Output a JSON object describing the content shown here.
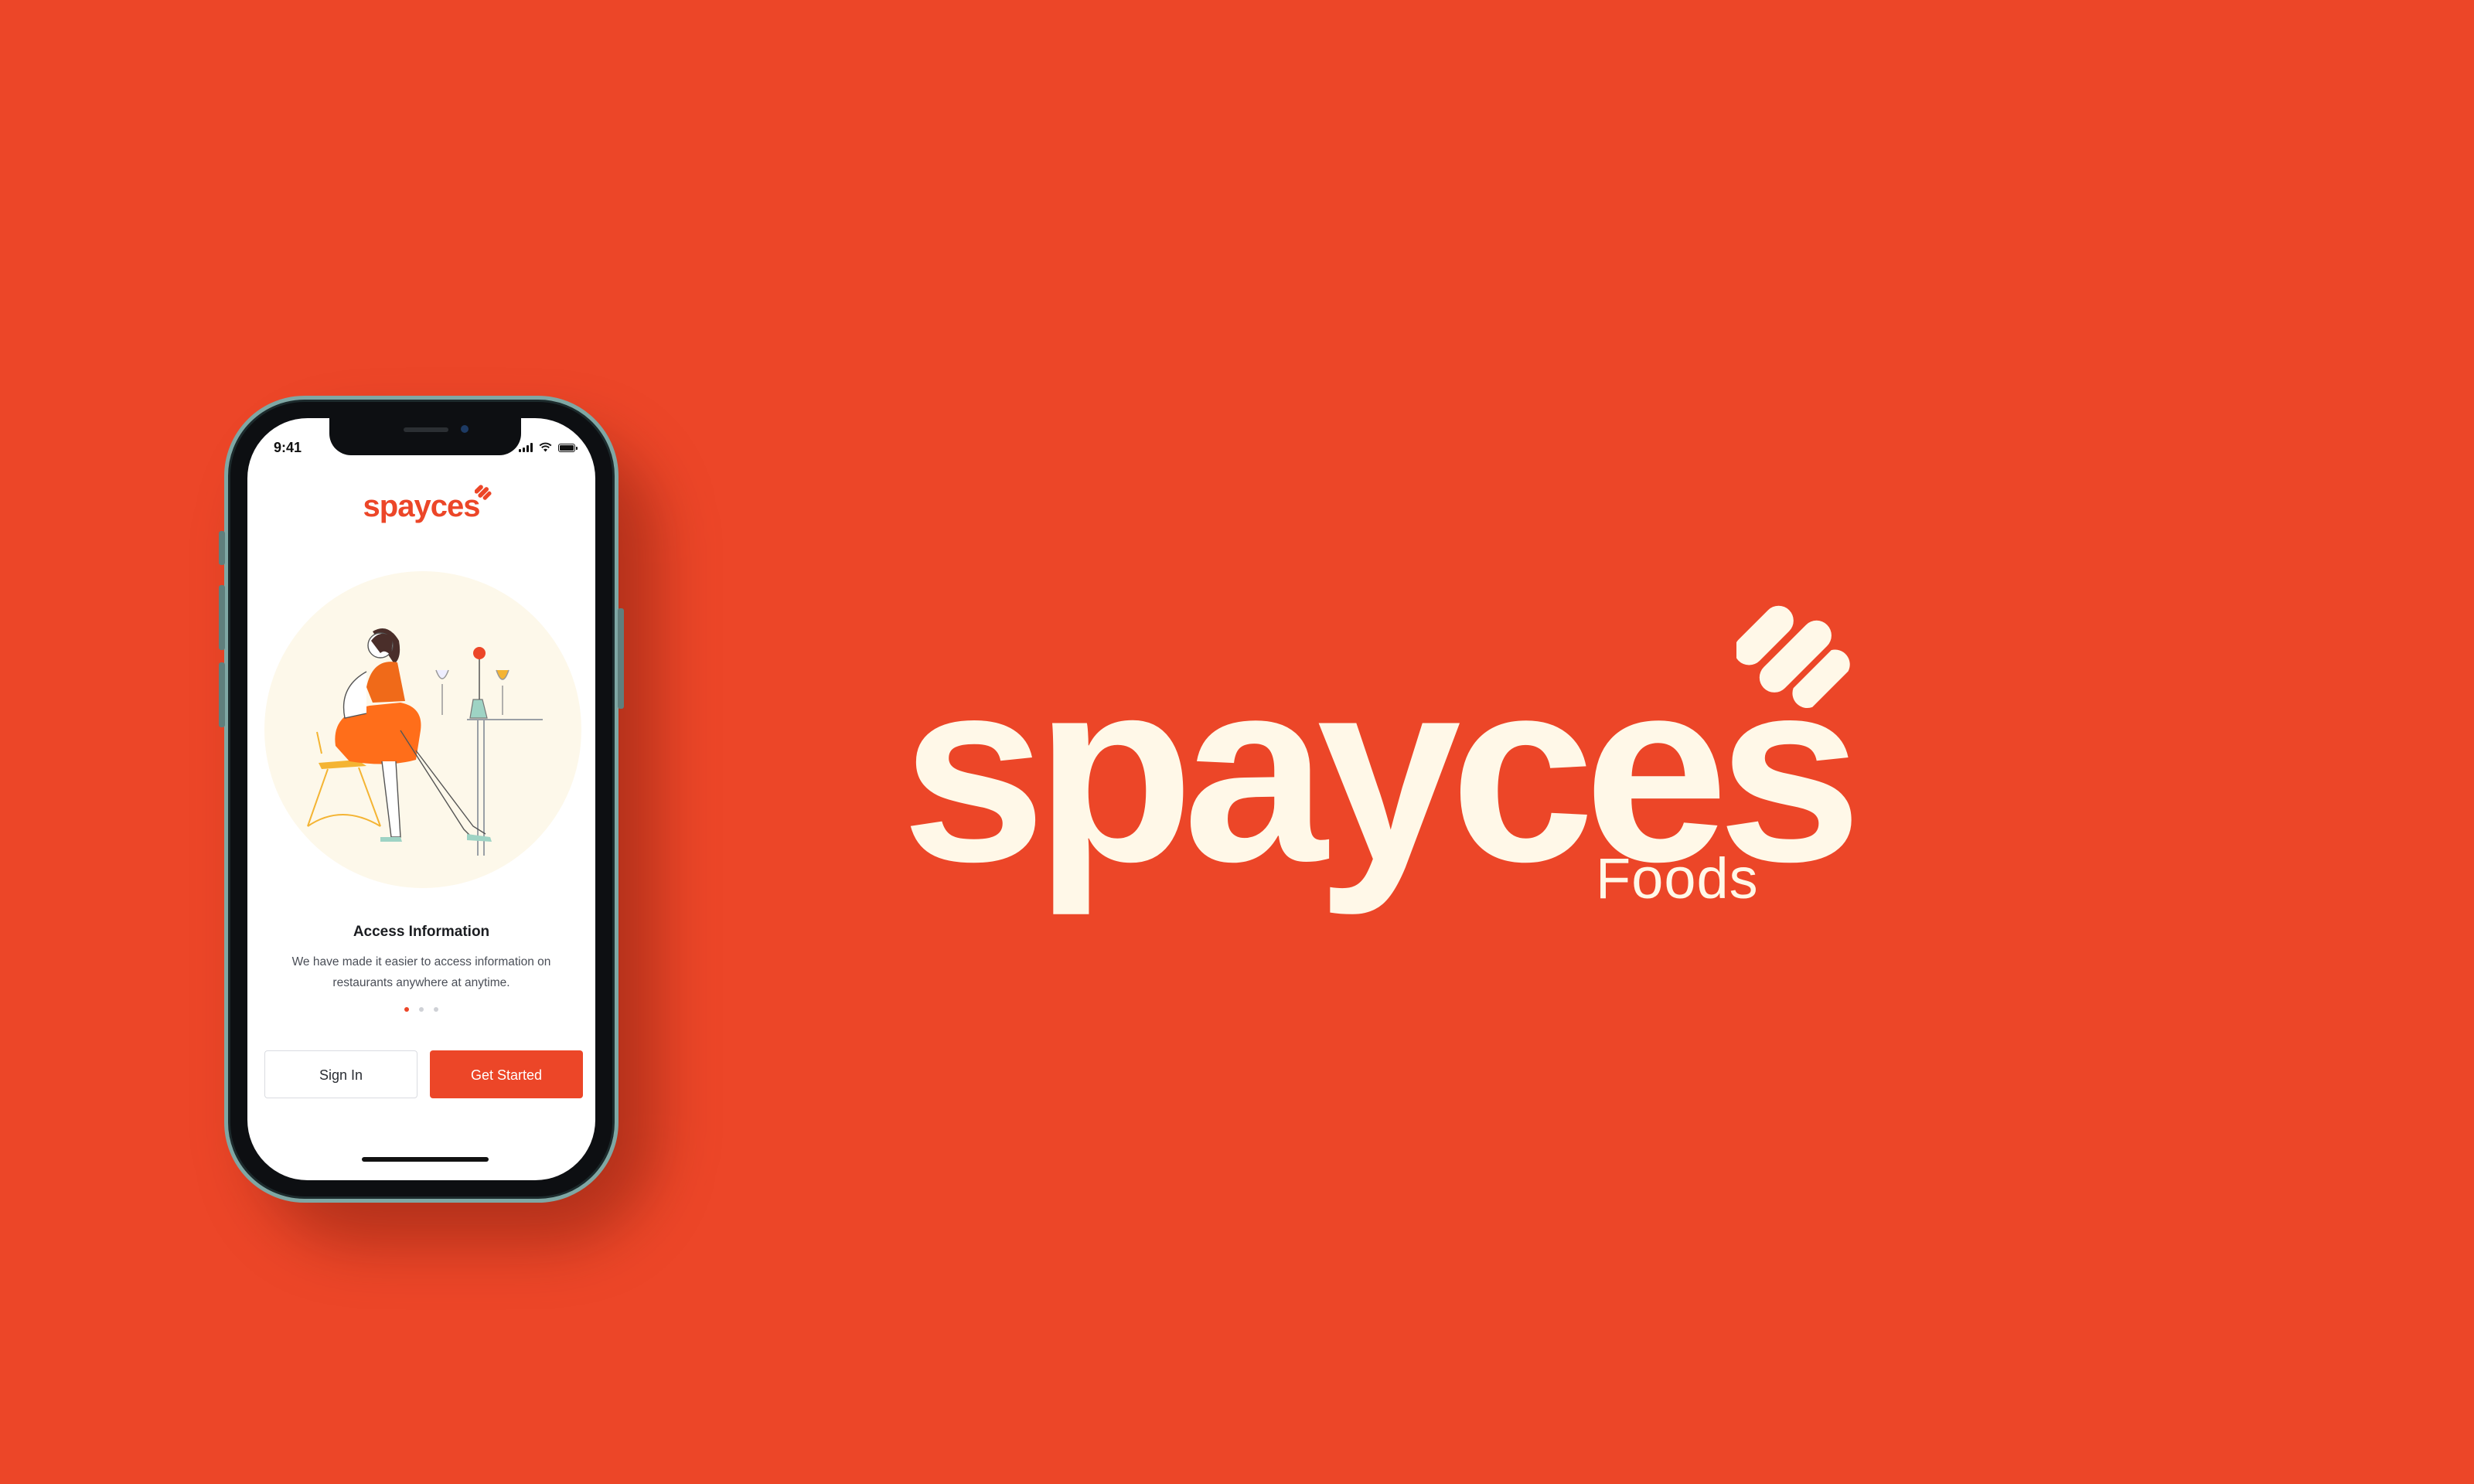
{
  "colors": {
    "brand": "#EC4628",
    "cream": "#FFF8E8",
    "phone_frame": "#7fa7a4"
  },
  "status_bar": {
    "time": "9:41"
  },
  "app": {
    "logo_text": "spayces",
    "onboarding": {
      "title": "Access Information",
      "description": "We have made it easier to access information on restaurants anywhere at anytime.",
      "pages_total": 3,
      "current_page": 1
    },
    "buttons": {
      "sign_in": "Sign In",
      "get_started": "Get Started"
    }
  },
  "brand": {
    "name": "spayces",
    "subtitle": "Foods"
  }
}
